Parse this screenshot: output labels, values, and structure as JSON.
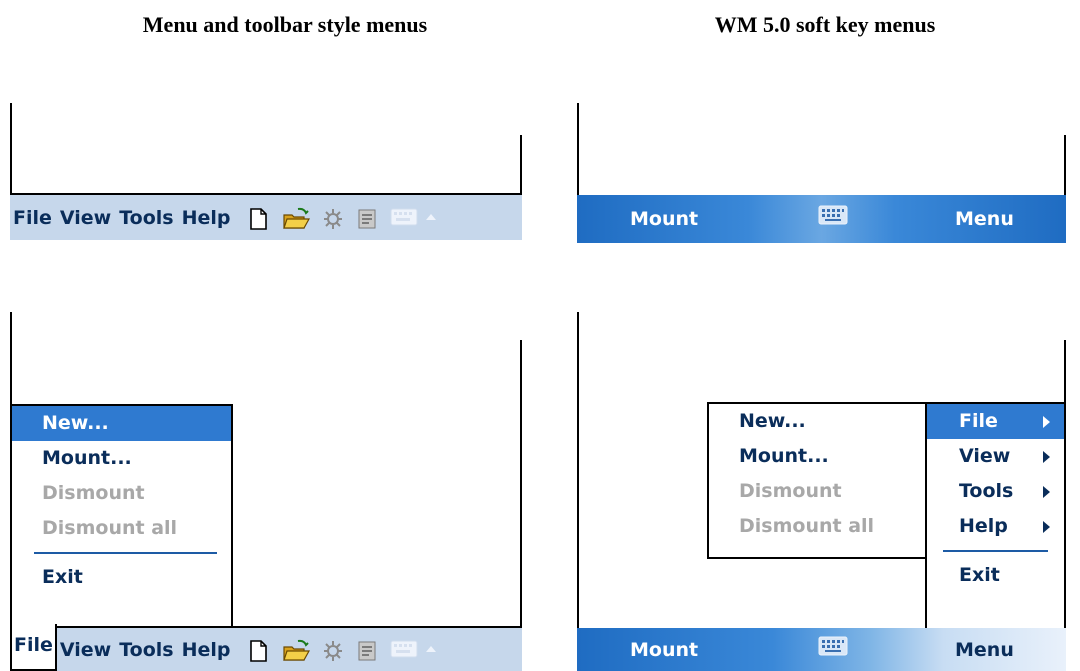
{
  "headings": {
    "left": "Menu and toolbar style menus",
    "right": "WM 5.0 soft key menus"
  },
  "menubar": {
    "items": [
      "File",
      "View",
      "Tools",
      "Help"
    ],
    "icons": [
      "new-document-icon",
      "open-folder-icon",
      "sync-icon",
      "properties-icon",
      "keyboard-icon",
      "up-arrow-icon"
    ]
  },
  "softkeys": {
    "left": "Mount",
    "right": "Menu",
    "center_icon": "keyboard-icon"
  },
  "file_menu": {
    "items": [
      {
        "label": "New...",
        "state": "selected"
      },
      {
        "label": "Mount...",
        "state": "enabled"
      },
      {
        "label": "Dismount",
        "state": "disabled"
      },
      {
        "label": "Dismount all",
        "state": "disabled"
      }
    ],
    "exit": "Exit"
  },
  "soft_menu": {
    "items": [
      {
        "label": "File",
        "state": "selected"
      },
      {
        "label": "View",
        "state": "enabled"
      },
      {
        "label": "Tools",
        "state": "enabled"
      },
      {
        "label": "Help",
        "state": "enabled"
      }
    ],
    "exit": "Exit"
  },
  "colors": {
    "menubar_bg": "#c6d7eb",
    "text": "#0a2d5a",
    "selection": "#2f7ad0",
    "softbar": "#1f6cc2",
    "disabled": "#a8a8a8"
  }
}
